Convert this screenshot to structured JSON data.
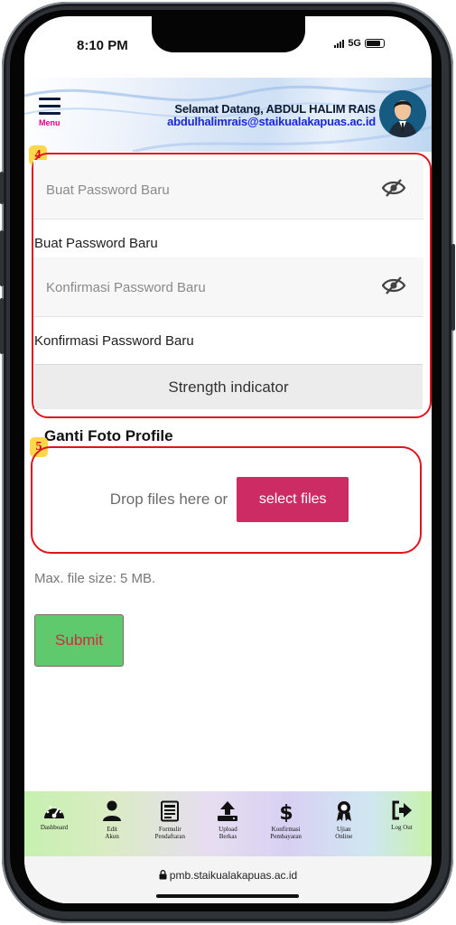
{
  "status_bar": {
    "time": "8:10 PM",
    "network": "5G",
    "icons": [
      "signal-icon",
      "battery-icon"
    ]
  },
  "header": {
    "menu_label": "Menu",
    "welcome": "Selamat Datang, ABDUL HALIM RAIS",
    "email": "abdulhalimrais@staikualakapuas.ac.id",
    "icons": [
      "menu-icon",
      "avatar-icon"
    ]
  },
  "password_section": {
    "badge": "4",
    "new_password": {
      "placeholder": "Buat Password Baru",
      "label": "Buat Password Baru"
    },
    "confirm_password": {
      "placeholder": "Konfirmasi Password Baru",
      "label": "Konfirmasi Password Baru"
    },
    "strength_indicator": "Strength indicator",
    "icons": [
      "eye-slash-icon"
    ]
  },
  "photo_section": {
    "badge": "5",
    "title": "Ganti Foto Profile",
    "drop_text": "Drop files here or",
    "select_files": "select files",
    "max_size": "Max. file size: 5 MB."
  },
  "submit_label": "Submit",
  "bottom_nav": [
    {
      "label": "Dashboard",
      "icon": "dashboard-icon"
    },
    {
      "label": "Edit\nAkun",
      "icon": "user-icon"
    },
    {
      "label": "Formulir\nPendaftaran",
      "icon": "form-icon"
    },
    {
      "label": "Upload\nBerkas",
      "icon": "upload-icon"
    },
    {
      "label": "Konfirmasi\nPembayaran",
      "icon": "dollar-icon"
    },
    {
      "label": "Ujian\nOnline",
      "icon": "award-icon"
    },
    {
      "label": "Log Out",
      "icon": "logout-icon"
    }
  ],
  "url": "pmb.staikualakapuas.ac.id",
  "colors": {
    "accent": "#cc2b63",
    "submit_bg": "#5fca6d",
    "annotation_red": "#e1141e",
    "email_blue": "#1a27d6",
    "badge_yellow": "#ffd84a"
  }
}
